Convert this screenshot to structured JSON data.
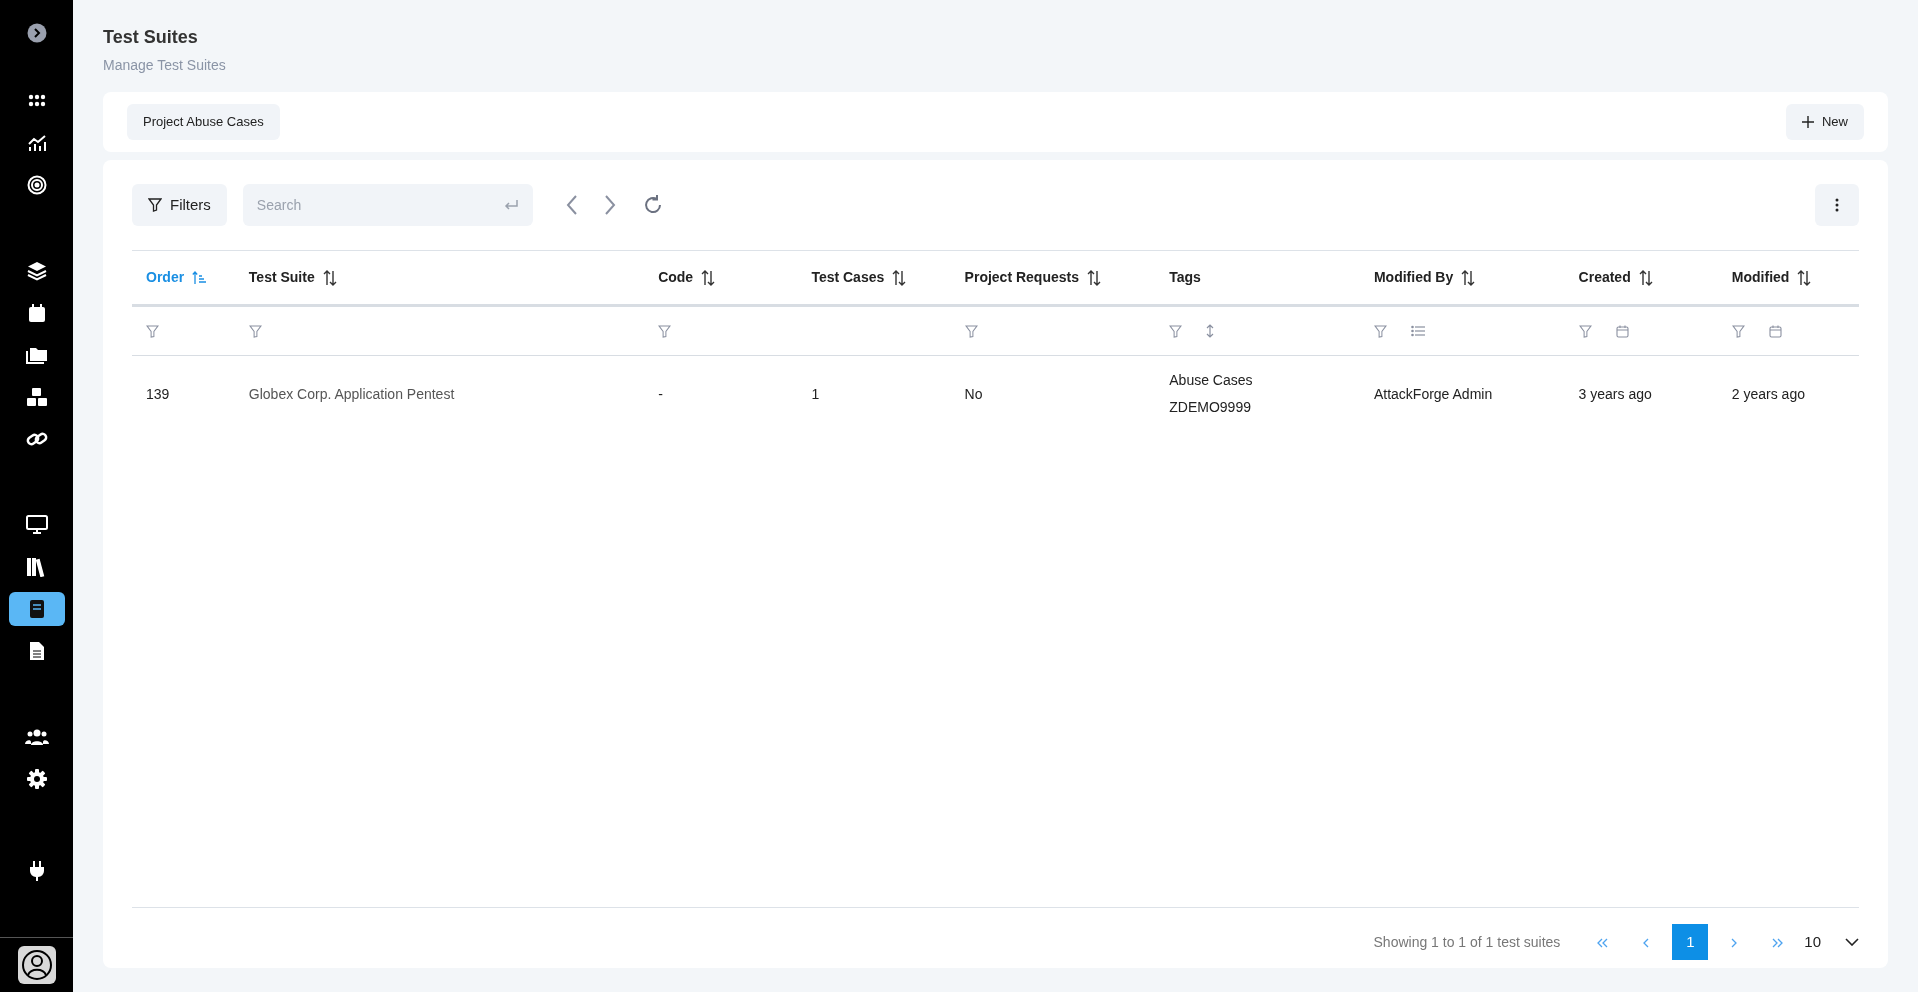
{
  "sidebar": {
    "toggle": {
      "expanded": false
    },
    "groups": [
      [
        {
          "selected": false
        },
        {
          "selected": false
        },
        {
          "selected": false
        }
      ],
      [
        {
          "selected": false
        },
        {
          "selected": false
        },
        {
          "selected": false
        },
        {
          "selected": false
        },
        {
          "selected": false
        }
      ],
      [
        {
          "selected": false
        },
        {
          "selected": false
        },
        {
          "selected": true
        },
        {
          "selected": false
        }
      ],
      [
        {
          "selected": false
        },
        {
          "selected": false
        }
      ],
      [
        {
          "selected": false
        }
      ]
    ]
  },
  "page": {
    "title": "Test Suites",
    "subtitle": "Manage Test Suites"
  },
  "top_bar": {
    "scope_button": "Project Abuse Cases",
    "new_button": "New"
  },
  "toolbar": {
    "filters_button": "Filters",
    "search": {
      "placeholder": "Search"
    }
  },
  "table": {
    "columns": [
      {
        "label": "Order",
        "sortable": true,
        "sorted": true,
        "filters": [
          {
            "kind": "filter"
          }
        ]
      },
      {
        "label": "Test Suite",
        "sortable": true,
        "sorted": false,
        "filters": [
          {
            "kind": "filter"
          }
        ]
      },
      {
        "label": "Code",
        "sortable": true,
        "sorted": false,
        "filters": [
          {
            "kind": "filter"
          }
        ]
      },
      {
        "label": "Test Cases",
        "sortable": true,
        "sorted": false
      },
      {
        "label": "Project Requests",
        "sortable": true,
        "sorted": false,
        "filters": [
          {
            "kind": "filter"
          }
        ]
      },
      {
        "label": "Tags",
        "sortable": false,
        "sorted": false,
        "filters": [
          {
            "kind": "filter"
          },
          {
            "kind": "resize"
          }
        ]
      },
      {
        "label": "Modified By",
        "sortable": true,
        "sorted": false,
        "filters": [
          {
            "kind": "filter"
          },
          {
            "kind": "list"
          }
        ]
      },
      {
        "label": "Created",
        "sortable": true,
        "sorted": false,
        "filters": [
          {
            "kind": "filter"
          },
          {
            "kind": "calendar"
          }
        ]
      },
      {
        "label": "Modified",
        "sortable": true,
        "sorted": false,
        "filters": [
          {
            "kind": "filter"
          },
          {
            "kind": "calendar"
          }
        ]
      }
    ],
    "rows": [
      {
        "cells": [
          "139",
          "Globex Corp. Application Pentest",
          "-",
          "1",
          "No",
          [
            "Abuse Cases",
            "ZDEMO9999"
          ],
          "AttackForge Admin",
          "3 years ago",
          "2 years ago"
        ]
      }
    ]
  },
  "pagination": {
    "summary": "Showing 1 to 1 of 1 test suites",
    "pages": [
      {
        "label": "1",
        "selected": true
      }
    ],
    "page_size": "10"
  }
}
